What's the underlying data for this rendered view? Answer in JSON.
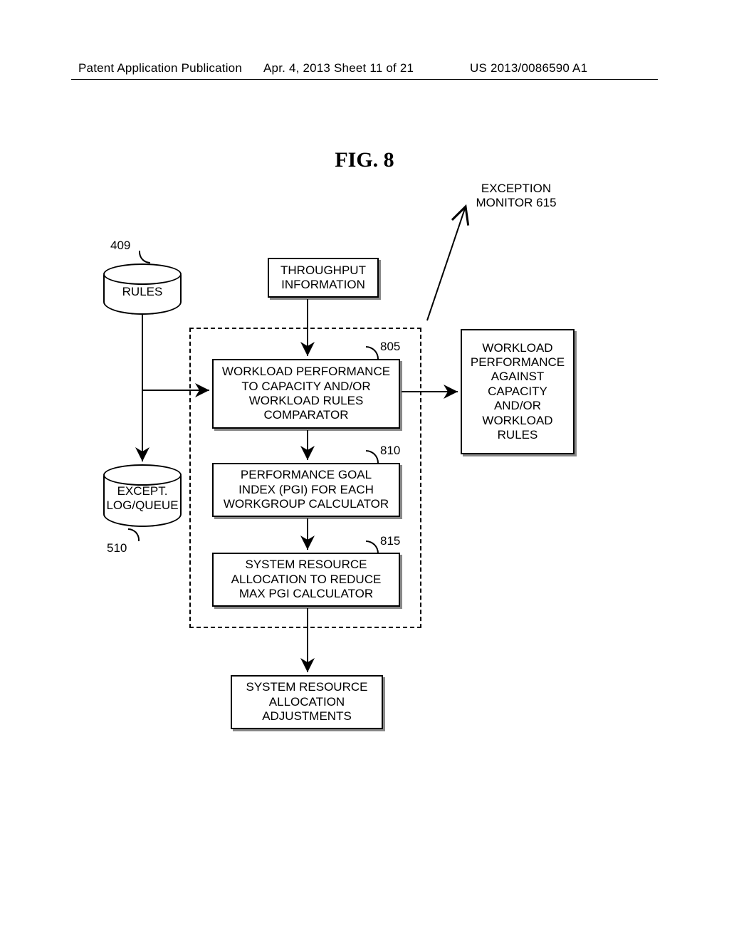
{
  "header": {
    "left": "Patent Application Publication",
    "center": "Apr. 4, 2013  Sheet 11 of 21",
    "right": "US 2013/0086590 A1"
  },
  "figure": {
    "title": "FIG. 8"
  },
  "labels": {
    "exception_monitor": "EXCEPTION MONITOR 615",
    "ref409": "409",
    "ref805": "805",
    "ref810": "810",
    "ref815": "815",
    "ref510": "510"
  },
  "nodes": {
    "rules": "RULES",
    "throughput": "THROUGHPUT INFORMATION",
    "comparator": "WORKLOAD PERFORMANCE TO CAPACITY AND/OR WORKLOAD RULES COMPARATOR",
    "pgi": "PERFORMANCE GOAL INDEX (PGI) FOR EACH WORKGROUP CALCULATOR",
    "sra": "SYSTEM RESOURCE ALLOCATION TO REDUCE MAX PGI CALCULATOR",
    "adjust": "SYSTEM RESOURCE ALLOCATION ADJUSTMENTS",
    "logqueue": "EXCEPT. LOG/QUEUE",
    "wperf": "WORKLOAD PERFORMANCE AGAINST CAPACITY AND/OR WORKLOAD RULES"
  }
}
